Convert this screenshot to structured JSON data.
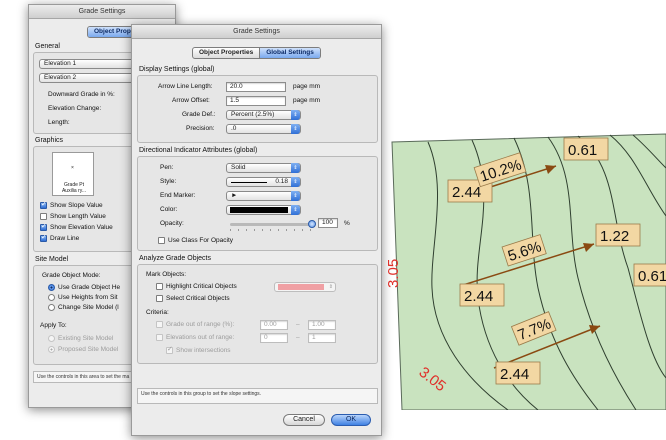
{
  "back_window": {
    "title": "Grade Settings",
    "tab_active": "Object Prope",
    "general": {
      "label": "General",
      "elevation1": "Elevation 1",
      "elevation2": "Elevation 2",
      "downward_grade": "Downward Grade in %:",
      "elevation_change": "Elevation Change:",
      "length": "Length:"
    },
    "graphics": {
      "label": "Graphics",
      "preview_title": "Grade Pt",
      "preview_sub": "Auxilia ry...",
      "show_slope": "Show Slope Value",
      "show_length": "Show Length Value",
      "show_elevation": "Show Elevation Value",
      "draw_line": "Draw Line"
    },
    "site_model": {
      "label": "Site Model",
      "mode_label": "Grade Object Mode:",
      "opt1": "Use Grade Object He",
      "opt2": "Use Heights from Sit",
      "opt3": "Change Site Model (l",
      "apply_to": "Apply To:",
      "existing": "Existing Site Model",
      "proposed": "Proposed Site Model"
    },
    "status": "Use the controls in this area to set the ma"
  },
  "front_window": {
    "title": "Grade Settings",
    "tabs": [
      "Object Properties",
      "Global Settings"
    ],
    "display": {
      "label": "Display Settings (global)",
      "arrow_line_length_label": "Arrow Line Length:",
      "arrow_line_length_value": "20.0",
      "arrow_line_length_unit": "page mm",
      "arrow_offset_label": "Arrow Offset:",
      "arrow_offset_value": "1.5",
      "arrow_offset_unit": "page mm",
      "grade_def_label": "Grade Def.:",
      "grade_def_value": "Percent (2.5%)",
      "precision_label": "Precision:",
      "precision_value": ".0"
    },
    "directional": {
      "label": "Directional Indicator Attributes (global)",
      "pen_label": "Pen:",
      "pen_value": "Solid",
      "style_label": "Style:",
      "style_value": "0.18",
      "end_marker_label": "End Marker:",
      "end_marker_value": "►",
      "color_label": "Color:",
      "color_value": "#000000",
      "opacity_label": "Opacity:",
      "opacity_value": "100",
      "opacity_unit": "%",
      "opacity_fraction": 1.0,
      "use_class": "Use Class For Opacity"
    },
    "analyze": {
      "label": "Analyze Grade Objects",
      "mark_objects": "Mark Objects:",
      "highlight": "Highlight Critical Objects",
      "highlight_color": "#f0a0a4",
      "select": "Select Critical Objects",
      "criteria": "Criteria:",
      "grade_out": "Grade out of range (%):",
      "grade_min": "0.00",
      "grade_max": "1.00",
      "elev_out": "Elevations out of range:",
      "elev_min": "0",
      "elev_max": "1",
      "range_sep": "–",
      "show_intersections": "Show intersections"
    },
    "status": "Use the controls in this group to set the slope settings.",
    "cancel": "Cancel",
    "ok": "OK"
  },
  "map": {
    "elevations": [
      "0.61",
      "1.22",
      "0.61",
      "2.44",
      "2.44",
      "2.44"
    ],
    "slopes": [
      "10.2%",
      "5.6%",
      "7.7%"
    ],
    "contour_labels": [
      "3.05",
      "3.05"
    ],
    "fill_color": "#c9e3bf",
    "label_bg": "#f2d7a3",
    "arrow_color": "#8a4a12",
    "contour_label_color": "#e0302a"
  }
}
